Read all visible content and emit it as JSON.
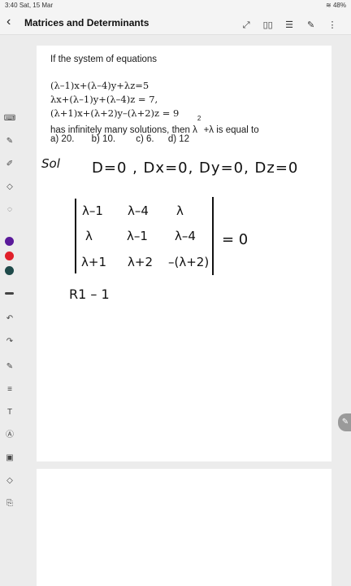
{
  "status": {
    "time": "3:40",
    "date": "Sat, 15 Mar",
    "battery": "48%"
  },
  "app": {
    "title": "Matrices and Determinants"
  },
  "question": {
    "intro": "If the system of equations",
    "eq1": "(λ–1)x+(λ–4)y+λz=5",
    "eq2": "λx+(λ–1)y+(λ–4)z = 7,",
    "eq3": "(λ+1)x+(λ+2)y–(λ+2)z = 9",
    "ask": "has infinitely many solutions, then λ",
    "power": "2",
    "ask_end": "+λ is equal to",
    "options": [
      "a) 20.",
      "b)  10.",
      "c) 6.",
      "d) 12"
    ]
  },
  "handwriting": {
    "sol": "Sol",
    "conditions": "D=0 , Dx=0, Dy=0, Dz=0",
    "matrix": [
      [
        "λ–1",
        "λ–4",
        "λ"
      ],
      [
        "λ",
        "λ–1",
        "λ–4"
      ],
      [
        "λ+1",
        "λ+2",
        "–(λ+2)"
      ]
    ],
    "equals": "= 0",
    "step": "R1 – 1"
  },
  "colors": {
    "purple": "#5a1a9a",
    "red": "#e0202a",
    "teal": "#1f4a4a"
  }
}
